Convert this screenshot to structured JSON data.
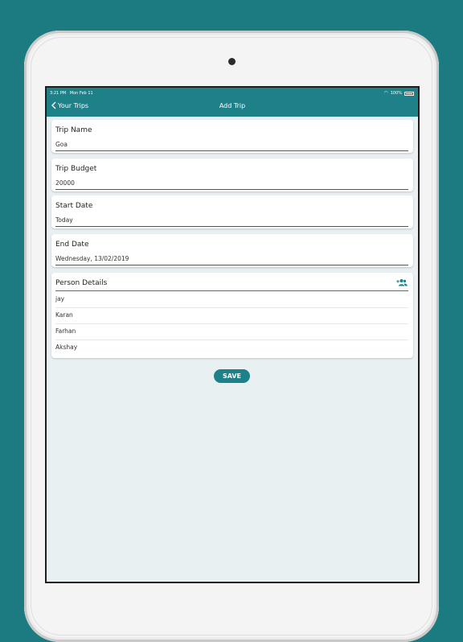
{
  "status_bar": {
    "time": "3:21 PM",
    "date": "Mon Feb 11",
    "battery": "100%",
    "wifi_icon": "wifi-icon",
    "battery_icon": "battery-icon"
  },
  "nav": {
    "back_label": "Your Trips",
    "title": "Add Trip"
  },
  "form": {
    "trip_name": {
      "label": "Trip Name",
      "value": "Goa"
    },
    "trip_budget": {
      "label": "Trip Budget",
      "value": "20000"
    },
    "start_date": {
      "label": "Start Date",
      "value": "Today"
    },
    "end_date": {
      "label": "End Date",
      "value": "Wednesday, 13/02/2019"
    }
  },
  "persons": {
    "label": "Person Details",
    "add_icon": "add-people-icon",
    "items": [
      "jay",
      "Karan",
      "Farhan",
      "Akshay"
    ]
  },
  "save_label": "SAVE",
  "colors": {
    "background": "#1b7b80",
    "accent": "#1e8088",
    "screen_bg": "#e9f0f1"
  }
}
